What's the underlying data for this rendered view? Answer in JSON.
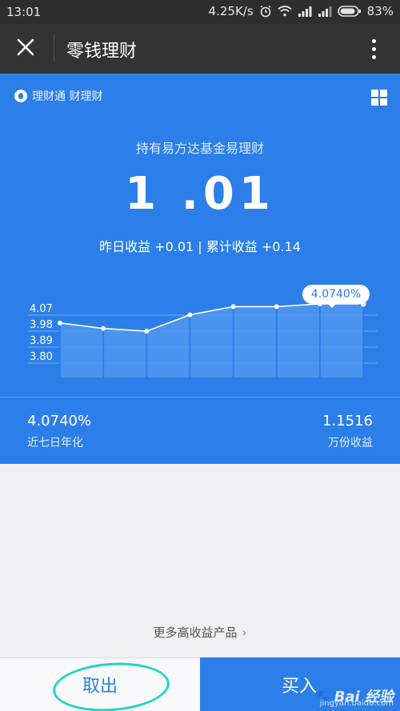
{
  "status_bar": {
    "time": "13:01",
    "network_speed": "4.25K/s",
    "battery": "83%"
  },
  "title_bar": {
    "title": "零钱理财",
    "close_icon": "close-icon",
    "more_icon": "more-vertical-icon"
  },
  "header": {
    "brand_label": "理财通  财理财",
    "grid_icon": "grid-icon"
  },
  "fund": {
    "name": "持有易方达基金易理财",
    "balance": "1 .01",
    "earnings": "昨日收益 +0.01 | 累计收益 +0.14"
  },
  "chart_data": {
    "type": "area",
    "y_tick_labels": [
      "4.07",
      "3.98",
      "3.89",
      "3.80"
    ],
    "values": [
      4.0,
      3.98,
      3.97,
      4.03,
      4.06,
      4.06,
      4.07,
      4.07
    ],
    "highlight_label": "4.0740%",
    "ylim": [
      3.8,
      4.07
    ]
  },
  "stats": {
    "annualized_value": "4.0740%",
    "annualized_label": "近七日年化",
    "per_10k_value": "1.1516",
    "per_10k_label": "万份收益"
  },
  "more_products": "更多高收益产品",
  "bottom": {
    "withdraw_label": "取出",
    "buy_label": "买入",
    "watermark": "Bai 经验",
    "watermark_sub": "jingyan.baidu.com"
  },
  "colors": {
    "primary_blue": "#2c7fe8",
    "annotation_circle": "#21d3c9"
  }
}
